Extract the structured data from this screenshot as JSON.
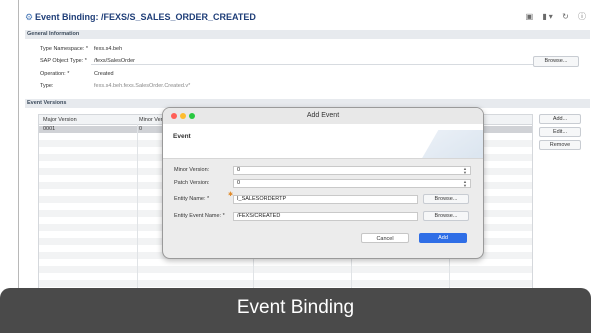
{
  "window": {
    "title": "Event Binding: /FEXS/S_SALES_ORDER_CREATED",
    "title_icon": "event-binding-icon"
  },
  "general": {
    "header": "General Information",
    "fields": [
      {
        "label": "Type Namespace: *",
        "value": "fexs.s4.beh"
      },
      {
        "label": "SAP Object Type: *",
        "value": "/fexs/SalesOrder"
      },
      {
        "label": "Operation: *",
        "value": "Created"
      },
      {
        "label": "Type:",
        "value": "fexs.s4.beh.fexs.SalesOrder.Created.v*"
      }
    ],
    "browse_label": "Browse..."
  },
  "versions": {
    "header": "Event Versions",
    "columns": [
      "Major Version",
      "Minor Vers"
    ],
    "rows": [
      {
        "major": "0001",
        "minor": "0"
      }
    ],
    "buttons": {
      "add": "Add...",
      "edit": "Edit...",
      "remove": "Remove"
    }
  },
  "dialog": {
    "title": "Add Event",
    "heading": "Event",
    "minor_version_label": "Minor Version:",
    "minor_version_value": "0",
    "patch_version_label": "Patch Version:",
    "patch_version_value": "0",
    "entity_name_label": "Entity Name: *",
    "entity_name_value": "I_SALESORDERTP",
    "entity_event_label": "Entity Event Name: *",
    "entity_event_value": "/FEXS/CREATED",
    "browse_label": "Browse...",
    "cancel_label": "Cancel",
    "add_label": "Add"
  },
  "caption": "Event Binding",
  "colors": {
    "accent": "#2f6ee6",
    "caption_bg": "#4a4a4a",
    "title_text": "#1f3e78"
  }
}
